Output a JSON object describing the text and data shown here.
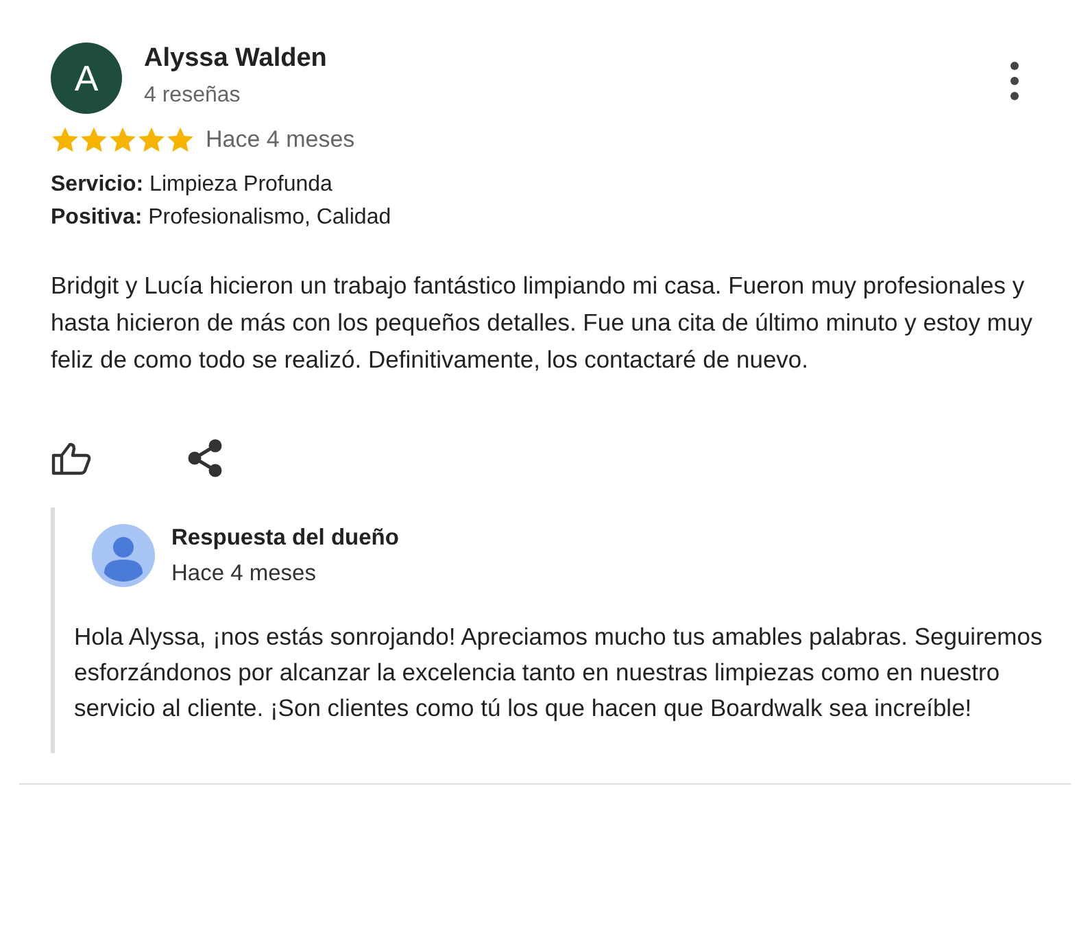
{
  "review": {
    "avatar_letter": "A",
    "author": "Alyssa Walden",
    "review_count": "4 reseñas",
    "stars": 5,
    "time": "Hace 4 meses",
    "details": [
      "**Servicio:** Limpieza Profunda",
      "**Positiva:** Profesionalismo, Calidad"
    ],
    "text": "Bridgit y Lucía hicieron un trabajo fantástico limpiando mi casa. Fueron muy profesionales y hasta hicieron de más con los pequeños detalles. Fue una cita de último minuto y estoy muy feliz de como todo se realizó. Definitivamente, los contactaré de nuevo."
  },
  "owner_response": {
    "title": "Respuesta del dueño",
    "time": "Hace 4 meses",
    "text": "Hola Alyssa, ¡nos estás sonrojando! Apreciamos mucho tus amables palabras. Seguiremos esforzándonos por alcanzar la excelencia tanto en nuestras limpiezas como en nuestro servicio al cliente. ¡Son clientes como tú los que hacen que Boardwalk sea increíble!"
  }
}
